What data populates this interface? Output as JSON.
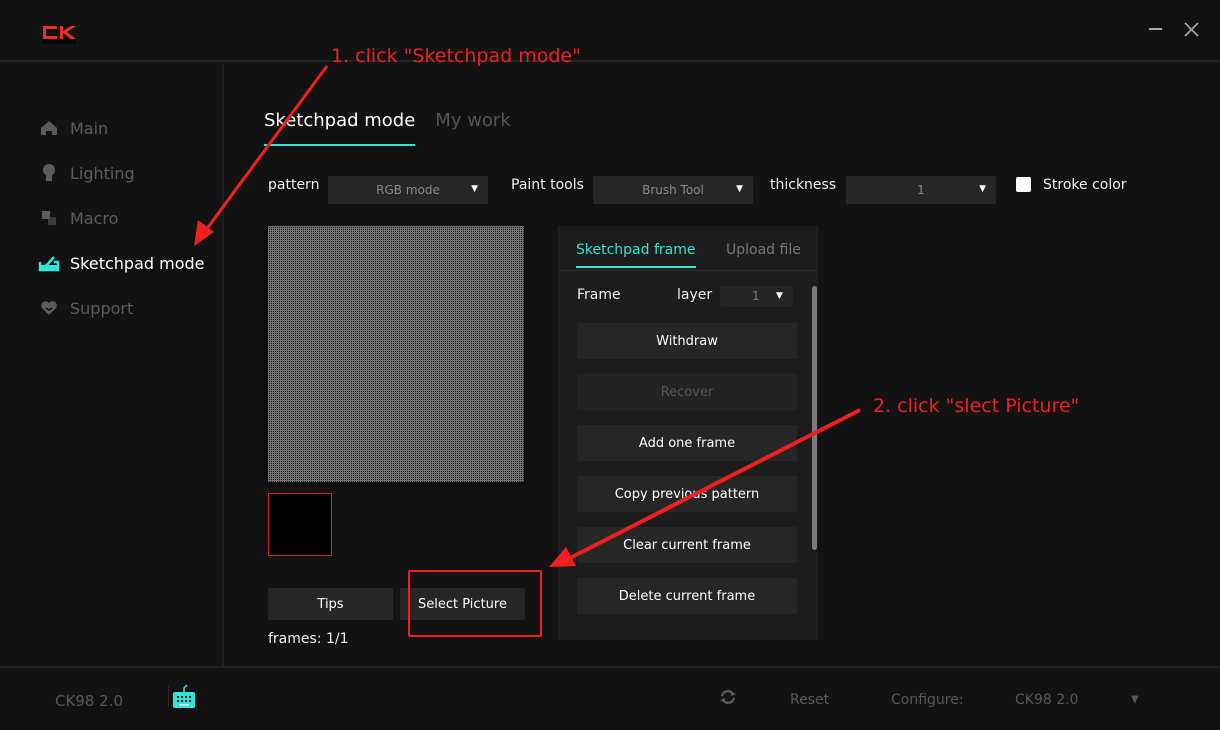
{
  "window": {
    "logo_text": "CK",
    "minimize_icon": "minimize-icon",
    "close_icon": "close-icon"
  },
  "sidebar": {
    "items": [
      {
        "label": "Main",
        "icon": "home-icon",
        "active": false
      },
      {
        "label": "Lighting",
        "icon": "bulb-icon",
        "active": false
      },
      {
        "label": "Macro",
        "icon": "macro-icon",
        "active": false
      },
      {
        "label": "Sketchpad mode",
        "icon": "sketchpad-icon",
        "active": true
      },
      {
        "label": "Support",
        "icon": "heart-icon",
        "active": false
      }
    ]
  },
  "tabs": [
    {
      "label": "Sketchpad mode",
      "active": true
    },
    {
      "label": "My work",
      "active": false
    }
  ],
  "toolbar": {
    "pattern_label": "pattern",
    "pattern_value": "RGB mode",
    "paint_tools_label": "Paint tools",
    "paint_tools_value": "Brush Tool",
    "thickness_label": "thickness",
    "thickness_value": "1",
    "stroke_color_label": "Stroke color",
    "stroke_color": "#ffffff"
  },
  "canvas": {
    "preview_color": "#000000"
  },
  "actions": {
    "tips_label": "Tips",
    "select_picture_label": "Select Picture",
    "frames_label": "frames: 1/1"
  },
  "panel": {
    "tabs": [
      {
        "label": "Sketchpad frame",
        "active": true
      },
      {
        "label": "Upload file",
        "active": false
      }
    ],
    "frame_label": "Frame",
    "layer_label": "layer",
    "layer_value": "1",
    "buttons": [
      {
        "label": "Withdraw",
        "enabled": true
      },
      {
        "label": "Recover",
        "enabled": false
      },
      {
        "label": "Add one frame",
        "enabled": true
      },
      {
        "label": "Copy previous pattern",
        "enabled": true
      },
      {
        "label": "Clear current frame",
        "enabled": true
      },
      {
        "label": "Delete current frame",
        "enabled": true
      }
    ]
  },
  "footer": {
    "device_name": "CK98 2.0",
    "reset_label": "Reset",
    "configure_label": "Configure:",
    "configure_value": "CK98 2.0"
  },
  "annotations": {
    "step1": "1. click \"Sketchpad mode\"",
    "step2": "2. click \"slect Picture\"",
    "color": "#f02020"
  },
  "colors": {
    "accent": "#2ee6d6",
    "background": "#121212",
    "button_bg": "#262626"
  }
}
